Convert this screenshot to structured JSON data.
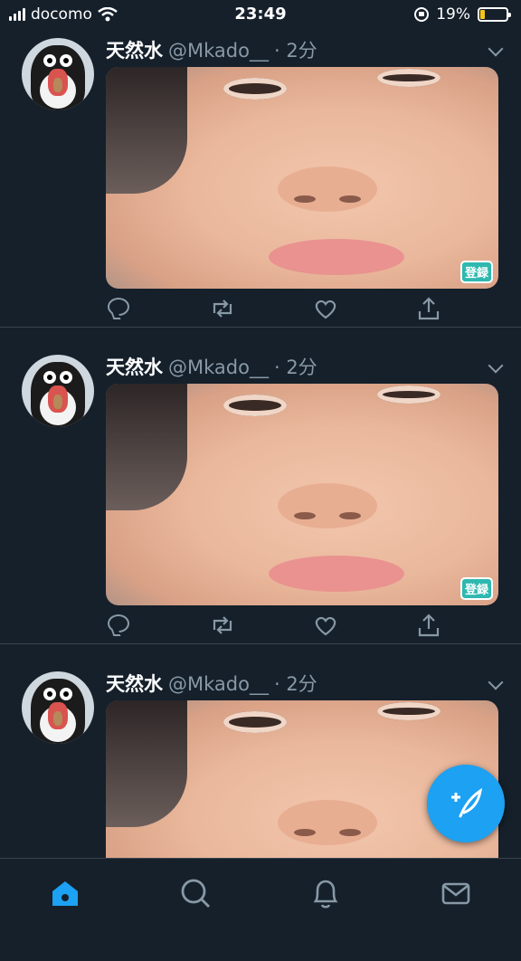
{
  "status_bar": {
    "carrier": "docomo",
    "time": "23:49",
    "battery": "19%",
    "battery_level": 0.19
  },
  "tweets": [
    {
      "name": "天然水",
      "handle": "@Mkado__",
      "time": "· 2分",
      "media_tag": "登録"
    },
    {
      "name": "天然水",
      "handle": "@Mkado__",
      "time": "· 2分",
      "media_tag": "登録"
    },
    {
      "name": "天然水",
      "handle": "@Mkado__",
      "time": "· 2分",
      "media_tag": ""
    }
  ],
  "icons": {
    "reply": "reply-icon",
    "retweet": "retweet-icon",
    "like": "heart-icon",
    "share": "share-icon",
    "compose": "compose-tweet-icon",
    "tabs": [
      "home-icon",
      "search-icon",
      "notifications-icon",
      "messages-icon"
    ]
  },
  "colors": {
    "background": "#15202b",
    "accent": "#1da1f2",
    "muted": "#8899a6"
  }
}
